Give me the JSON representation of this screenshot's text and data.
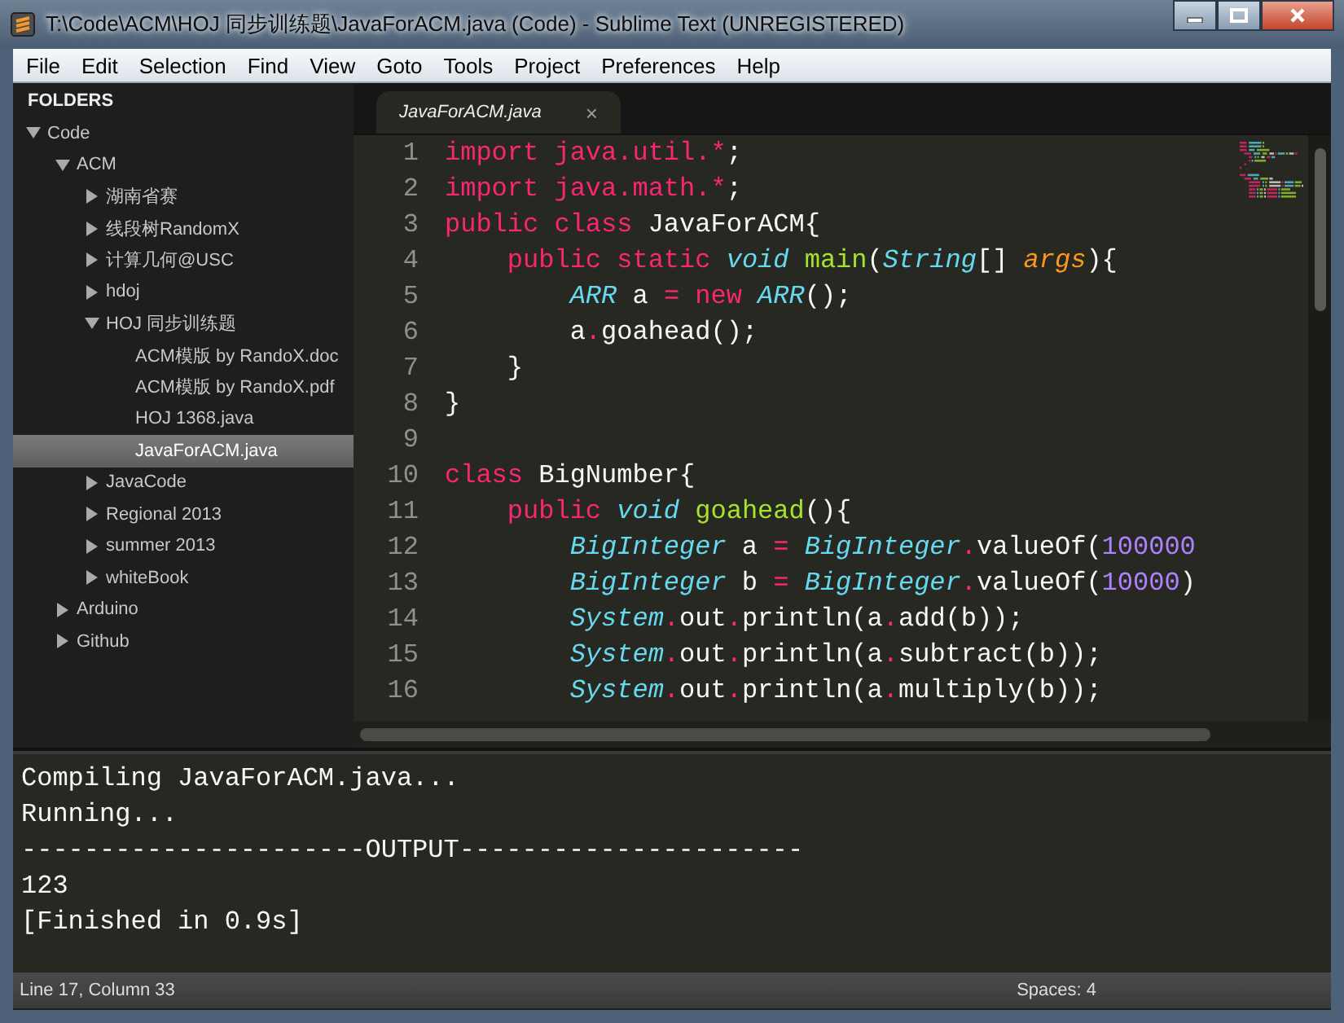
{
  "window": {
    "title": "T:\\Code\\ACM\\HOJ 同步训练题\\JavaForACM.java (Code) - Sublime Text (UNREGISTERED)"
  },
  "menu": [
    "File",
    "Edit",
    "Selection",
    "Find",
    "View",
    "Goto",
    "Tools",
    "Project",
    "Preferences",
    "Help"
  ],
  "sidebar": {
    "header": "FOLDERS",
    "items": [
      {
        "kind": "folder",
        "label": "Code",
        "expanded": true,
        "children": [
          {
            "kind": "folder",
            "label": "ACM",
            "expanded": true,
            "children": [
              {
                "kind": "folder",
                "label": "湖南省赛",
                "expanded": false
              },
              {
                "kind": "folder",
                "label": "线段树RandomX",
                "expanded": false
              },
              {
                "kind": "folder",
                "label": "计算几何@USC",
                "expanded": false
              },
              {
                "kind": "folder",
                "label": "hdoj",
                "expanded": false
              },
              {
                "kind": "folder",
                "label": "HOJ 同步训练题",
                "expanded": true,
                "children": [
                  {
                    "kind": "file",
                    "label": "ACM模版 by RandoX.doc",
                    "selected": false
                  },
                  {
                    "kind": "file",
                    "label": "ACM模版 by RandoX.pdf",
                    "selected": false
                  },
                  {
                    "kind": "file",
                    "label": "HOJ 1368.java",
                    "selected": false
                  },
                  {
                    "kind": "file",
                    "label": "JavaForACM.java",
                    "selected": true
                  }
                ]
              },
              {
                "kind": "folder",
                "label": "JavaCode",
                "expanded": false
              },
              {
                "kind": "folder",
                "label": "Regional 2013",
                "expanded": false
              },
              {
                "kind": "folder",
                "label": "summer 2013",
                "expanded": false
              },
              {
                "kind": "folder",
                "label": "whiteBook",
                "expanded": false
              }
            ]
          },
          {
            "kind": "folder",
            "label": "Arduino",
            "expanded": false
          },
          {
            "kind": "folder",
            "label": "Github",
            "expanded": false
          }
        ]
      }
    ]
  },
  "tabs": [
    {
      "label": "JavaForACM.java",
      "close": "×",
      "selected": true
    }
  ],
  "code": [
    {
      "number": "1",
      "tokens": [
        {
          "kind": "kw",
          "text": "import"
        },
        {
          "kind": "kw",
          "text": " java.util.*"
        },
        {
          "kind": "plain",
          "text": ";"
        }
      ]
    },
    {
      "number": "2",
      "tokens": [
        {
          "kind": "kw",
          "text": "import"
        },
        {
          "kind": "kw",
          "text": " java.math.*"
        },
        {
          "kind": "plain",
          "text": ";"
        }
      ]
    },
    {
      "number": "3",
      "tokens": [
        {
          "kind": "kw",
          "text": "public"
        },
        {
          "kind": "kw",
          "text": " class"
        },
        {
          "kind": "plain",
          "text": " JavaForACM{"
        }
      ]
    },
    {
      "number": "4",
      "tokens": [
        {
          "kind": "kw",
          "text": "    public"
        },
        {
          "kind": "kw",
          "text": " static"
        },
        {
          "kind": "type",
          "text": " void"
        },
        {
          "kind": "fn",
          "text": " main"
        },
        {
          "kind": "plain",
          "text": "("
        },
        {
          "kind": "type",
          "text": "String"
        },
        {
          "kind": "plain",
          "text": "[] "
        },
        {
          "kind": "param",
          "text": "args"
        },
        {
          "kind": "plain",
          "text": "){"
        }
      ]
    },
    {
      "number": "5",
      "tokens": [
        {
          "kind": "type",
          "text": "        ARR"
        },
        {
          "kind": "plain",
          "text": " a "
        },
        {
          "kind": "kw",
          "text": "="
        },
        {
          "kind": "kw",
          "text": " new"
        },
        {
          "kind": "type",
          "text": " ARR"
        },
        {
          "kind": "plain",
          "text": "();"
        }
      ]
    },
    {
      "number": "6",
      "tokens": [
        {
          "kind": "plain",
          "text": "        a"
        },
        {
          "kind": "kw",
          "text": "."
        },
        {
          "kind": "plain",
          "text": "goahead();"
        }
      ]
    },
    {
      "number": "7",
      "tokens": [
        {
          "kind": "plain",
          "text": "    }"
        }
      ]
    },
    {
      "number": "8",
      "tokens": [
        {
          "kind": "plain",
          "text": "}"
        }
      ]
    },
    {
      "number": "9"
    },
    {
      "number": "10",
      "tokens": [
        {
          "kind": "kw",
          "text": "class"
        },
        {
          "kind": "plain",
          "text": " BigNumber{"
        }
      ]
    },
    {
      "number": "11",
      "tokens": [
        {
          "kind": "kw",
          "text": "    public"
        },
        {
          "kind": "type",
          "text": " void"
        },
        {
          "kind": "fn",
          "text": " goahead"
        },
        {
          "kind": "plain",
          "text": "(){"
        }
      ]
    },
    {
      "number": "12",
      "tokens": [
        {
          "kind": "type",
          "text": "        BigInteger"
        },
        {
          "kind": "plain",
          "text": " a "
        },
        {
          "kind": "kw",
          "text": "="
        },
        {
          "kind": "type",
          "text": " BigInteger"
        },
        {
          "kind": "kw",
          "text": "."
        },
        {
          "kind": "plain",
          "text": "valueOf("
        },
        {
          "kind": "num",
          "text": "100000"
        }
      ]
    },
    {
      "number": "13",
      "tokens": [
        {
          "kind": "type",
          "text": "        BigInteger"
        },
        {
          "kind": "plain",
          "text": " b "
        },
        {
          "kind": "kw",
          "text": "="
        },
        {
          "kind": "type",
          "text": " BigInteger"
        },
        {
          "kind": "kw",
          "text": "."
        },
        {
          "kind": "plain",
          "text": "valueOf("
        },
        {
          "kind": "num",
          "text": "10000"
        },
        {
          "kind": "plain",
          "text": ")"
        }
      ]
    },
    {
      "number": "14",
      "tokens": [
        {
          "kind": "type",
          "text": "        System"
        },
        {
          "kind": "kw",
          "text": "."
        },
        {
          "kind": "plain",
          "text": "out"
        },
        {
          "kind": "kw",
          "text": "."
        },
        {
          "kind": "plain",
          "text": "println(a"
        },
        {
          "kind": "kw",
          "text": "."
        },
        {
          "kind": "plain",
          "text": "add(b));"
        }
      ]
    },
    {
      "number": "15",
      "tokens": [
        {
          "kind": "type",
          "text": "        System"
        },
        {
          "kind": "kw",
          "text": "."
        },
        {
          "kind": "plain",
          "text": "out"
        },
        {
          "kind": "kw",
          "text": "."
        },
        {
          "kind": "plain",
          "text": "println(a"
        },
        {
          "kind": "kw",
          "text": "."
        },
        {
          "kind": "plain",
          "text": "subtract(b));"
        }
      ]
    },
    {
      "number": "16",
      "tokens": [
        {
          "kind": "type",
          "text": "        System"
        },
        {
          "kind": "kw",
          "text": "."
        },
        {
          "kind": "plain",
          "text": "out"
        },
        {
          "kind": "kw",
          "text": "."
        },
        {
          "kind": "plain",
          "text": "println(a"
        },
        {
          "kind": "kw",
          "text": "."
        },
        {
          "kind": "plain",
          "text": "multiply(b));"
        }
      ]
    }
  ],
  "output": [
    "Compiling JavaForACM.java...",
    "Running...",
    "----------------------OUTPUT----------------------",
    "123",
    "[Finished in 0.9s]"
  ],
  "status_bar": {
    "position": "Line 17, Column 33",
    "indentation": "Spaces: 4"
  }
}
